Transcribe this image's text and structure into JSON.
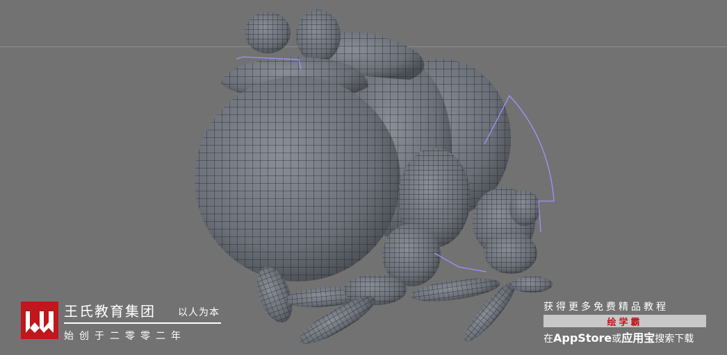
{
  "viewport": {
    "background_color": "#727272",
    "model_color": "#6b7078",
    "wire_color": "#1d1f24",
    "selection_color": "#9d93ff"
  },
  "brand": {
    "name": "王氏教育集团",
    "slogan": "以人为本",
    "founded": "始创于二零零二年",
    "logo_color": "#c0161c",
    "logo_glyph": "W-logo-icon"
  },
  "promo": {
    "top_text": "获得更多免费精品教程",
    "app_name": "绘学霸",
    "bottom_prefix": "在",
    "bottom_store": "AppStore",
    "bottom_or": "或",
    "bottom_store2": "应用宝",
    "bottom_suffix": "搜索下载"
  }
}
